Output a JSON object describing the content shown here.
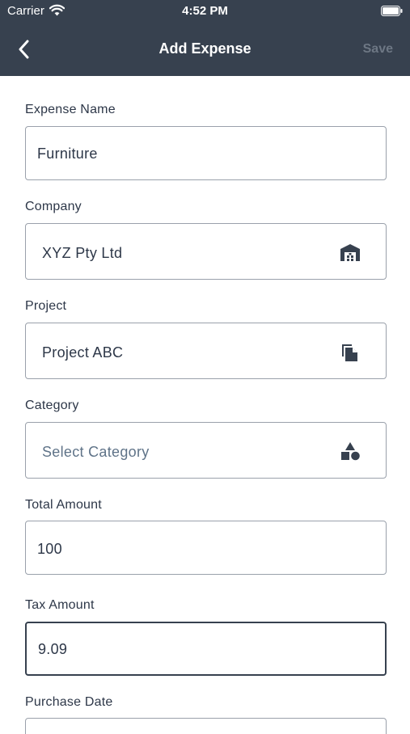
{
  "status_bar": {
    "carrier": "Carrier",
    "time": "4:52 PM",
    "wifi_icon": "wifi-icon",
    "battery_icon": "battery-full-icon"
  },
  "nav": {
    "back_icon": "chevron-left-icon",
    "title": "Add Expense",
    "save_label": "Save"
  },
  "form": {
    "expense_name": {
      "label": "Expense Name",
      "value": "Furniture"
    },
    "company": {
      "label": "Company",
      "value": "XYZ Pty Ltd",
      "icon": "warehouse-icon"
    },
    "project": {
      "label": "Project",
      "value": "Project ABC",
      "icon": "documents-icon"
    },
    "category": {
      "label": "Category",
      "placeholder": "Select Category",
      "icon": "shapes-icon"
    },
    "total_amount": {
      "label": "Total Amount",
      "value": "100"
    },
    "tax_amount": {
      "label": "Tax Amount",
      "value": "9.09"
    },
    "purchase_date": {
      "label": "Purchase Date"
    }
  },
  "colors": {
    "header": "#37414f",
    "text": "#2d3748",
    "placeholder": "#5f7388",
    "save_disabled": "#6d7784",
    "border": "#9aa1ab"
  }
}
